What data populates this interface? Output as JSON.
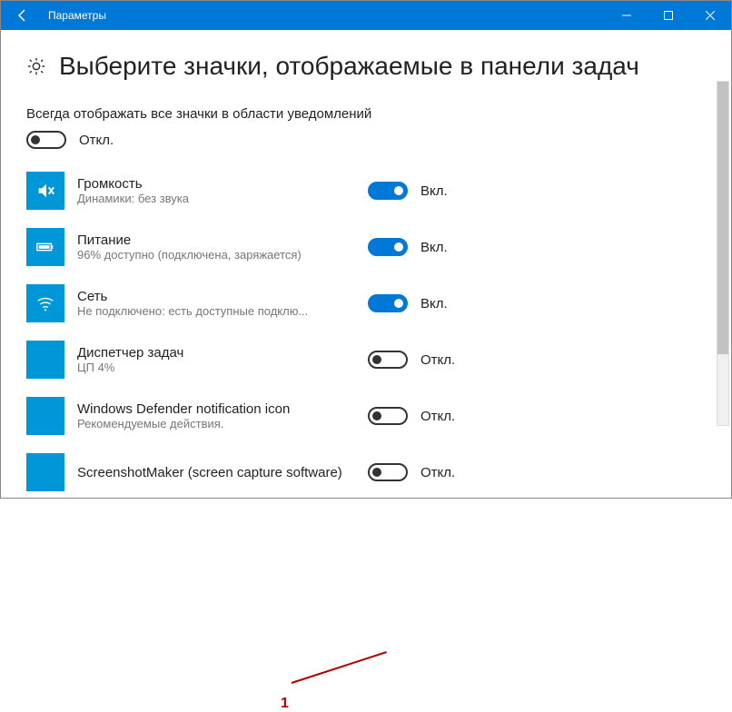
{
  "window": {
    "title": "Параметры"
  },
  "page": {
    "heading": "Выберите значки, отображаемые в панели задач"
  },
  "master": {
    "label": "Всегда отображать все значки в области уведомлений",
    "state_label": "Откл.",
    "on": false
  },
  "labels": {
    "on": "Вкл.",
    "off": "Откл."
  },
  "annotation": {
    "marker": "1"
  },
  "items": [
    {
      "title": "Громкость",
      "sub": "Динамики: без звука",
      "on": true,
      "icon": "volume"
    },
    {
      "title": "Питание",
      "sub": "96% доступно (подключена, заряжается)",
      "on": true,
      "icon": "battery"
    },
    {
      "title": "Сеть",
      "sub": "Не подключено: есть доступные подклю...",
      "on": true,
      "icon": "wifi"
    },
    {
      "title": "Диспетчер задач",
      "sub": "ЦП 4%",
      "on": false,
      "icon": "blank"
    },
    {
      "title": "Windows Defender notification icon",
      "sub": "Рекомендуемые действия.",
      "on": false,
      "icon": "blank"
    },
    {
      "title": "ScreenshotMaker (screen capture software)",
      "sub": "",
      "on": false,
      "icon": "blank"
    }
  ]
}
